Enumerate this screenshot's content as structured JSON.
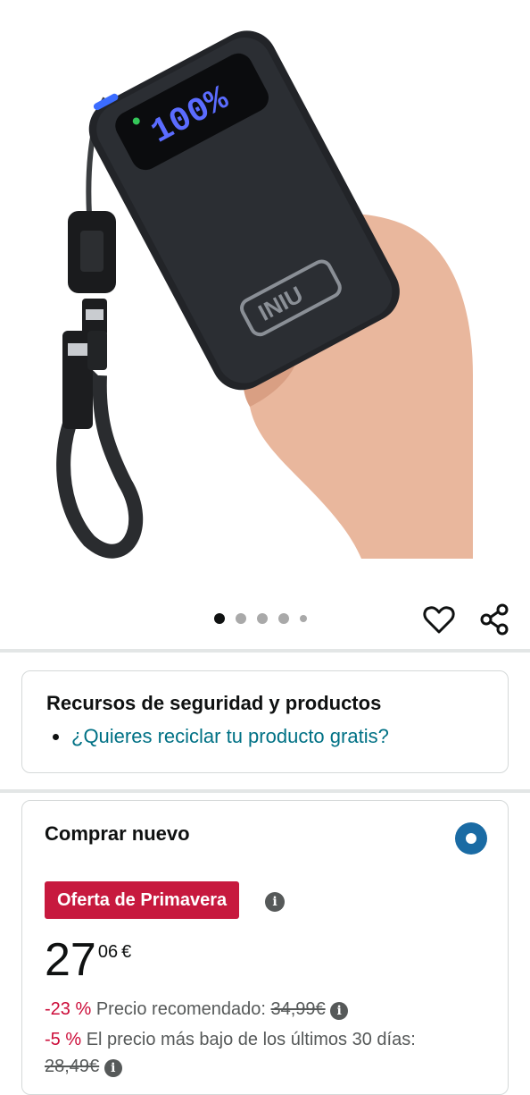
{
  "product": {
    "device_brand": "INIU",
    "device_display": "100%"
  },
  "carousel": {
    "count": 5,
    "active_index": 0
  },
  "safety_card": {
    "title": "Recursos de seguridad y productos",
    "link": "¿Quieres reciclar tu producto gratis?"
  },
  "buy_card": {
    "title": "Comprar nuevo",
    "badge": "Oferta de Primavera",
    "info_icon": "i",
    "price_whole": "27",
    "price_fraction": "06",
    "currency": "€",
    "discount_pct": "-23 %",
    "list_price_label": "Precio recomendado:",
    "list_price": "34,99€",
    "low_pct": "-5 %",
    "low_label": "El precio más bajo de los últimos 30 días:",
    "low_price": "28,49€"
  },
  "colors": {
    "link": "#007185",
    "badge_bg": "#c7193e",
    "discount": "#cc0c39",
    "radio": "#1a6ba4"
  }
}
